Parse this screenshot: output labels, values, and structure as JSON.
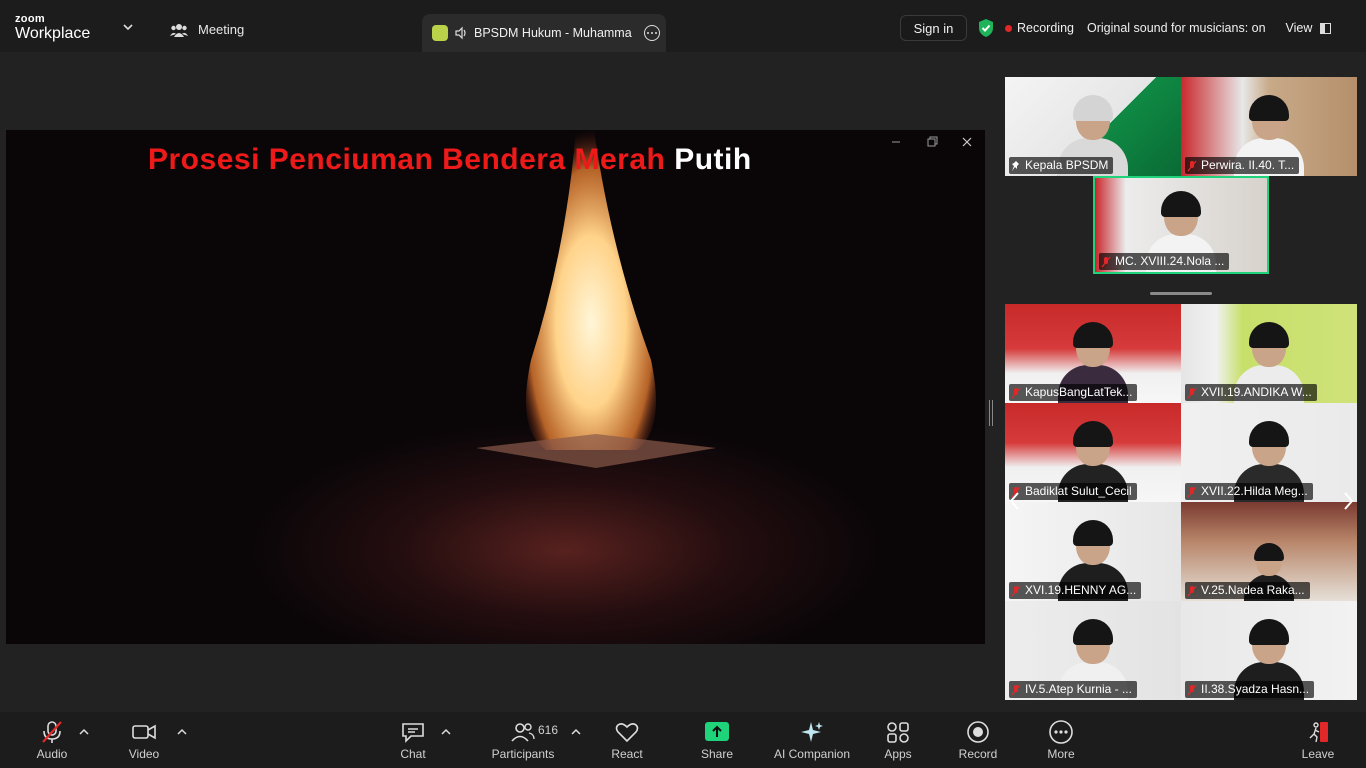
{
  "app": {
    "logo_small": "zoom",
    "logo_big": "Workplace"
  },
  "topbar": {
    "meeting_label": "Meeting",
    "tab_title": "BPSDM Hukum - Muhamma",
    "sign_in": "Sign in",
    "recording": "Recording",
    "original_sound": "Original sound for musicians: on",
    "view": "View"
  },
  "shared_screen": {
    "caption_red": "Prosesi Penciuman Bendera Merah",
    "caption_white": "Putih"
  },
  "gallery": {
    "top_tiles": [
      {
        "name": "Kepala BPSDM"
      },
      {
        "name": "Perwira. II.40. T..."
      },
      {
        "name": "MC. XVIII.24.Nola ..."
      }
    ],
    "tiles": [
      {
        "name": "KapusBangLatTek..."
      },
      {
        "name": "XVII.19.ANDIKA W..."
      },
      {
        "name": "Badiklat Sulut_Cecil"
      },
      {
        "name": "XVII.22.Hilda Meg..."
      },
      {
        "name": "XVI.19.HENNY AG..."
      },
      {
        "name": "V.25.Nadea Raka..."
      },
      {
        "name": "IV.5.Atep Kurnia - ..."
      },
      {
        "name": "II.38.Syadza Hasn..."
      }
    ]
  },
  "toolbar": {
    "audio": "Audio",
    "video": "Video",
    "chat": "Chat",
    "participants": "Participants",
    "participant_count": "616",
    "react": "React",
    "share": "Share",
    "ai_companion": "AI Companion",
    "apps": "Apps",
    "record": "Record",
    "more": "More",
    "leave": "Leave"
  },
  "colors": {
    "accent_green": "#1fd37a",
    "share_green": "#1fd37a",
    "recording_red": "#e02828",
    "leave_red": "#e02828",
    "caption_red": "#ee1a1a"
  }
}
